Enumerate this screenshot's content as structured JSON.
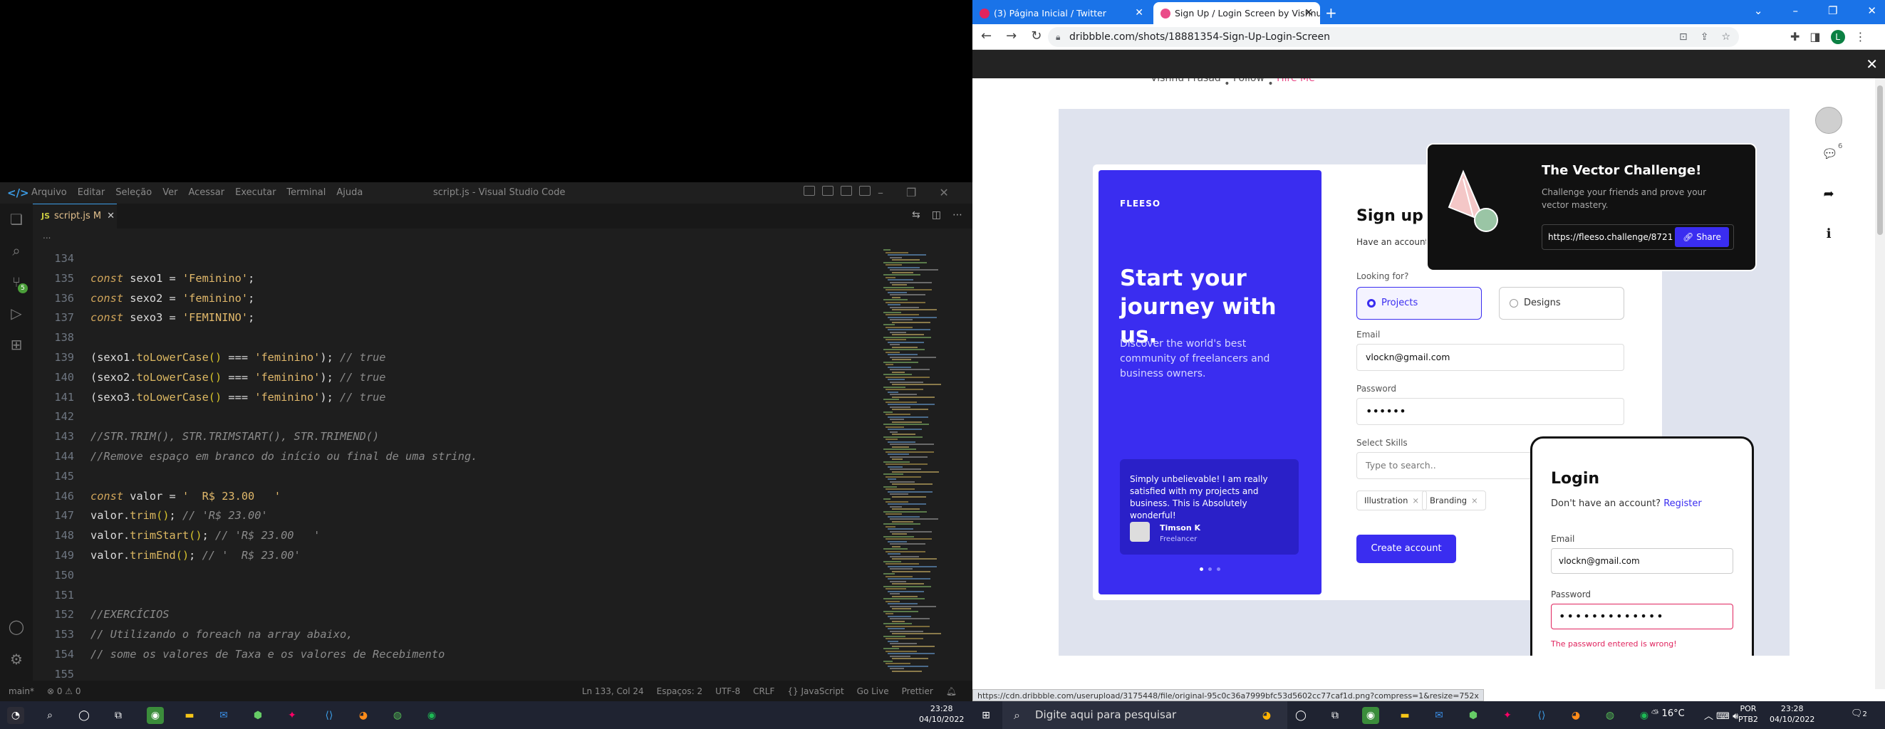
{
  "vscode": {
    "menu": [
      "Arquivo",
      "Editar",
      "Seleção",
      "Ver",
      "Acessar",
      "Executar",
      "Terminal",
      "Ajuda"
    ],
    "window_title": "script.js - Visual Studio Code",
    "tab": {
      "label": "script.js",
      "modified": "M"
    },
    "breadcrumb": "...",
    "lines": [
      {
        "n": "134",
        "tokens": []
      },
      {
        "n": "135",
        "tokens": [
          [
            "kw",
            "const"
          ],
          [
            "t",
            " sexo1 = "
          ],
          [
            "str",
            "'Feminino'"
          ],
          [
            "t",
            ";"
          ]
        ]
      },
      {
        "n": "136",
        "tokens": [
          [
            "kw",
            "const"
          ],
          [
            "t",
            " sexo2 = "
          ],
          [
            "str",
            "'feminino'"
          ],
          [
            "t",
            ";"
          ]
        ]
      },
      {
        "n": "137",
        "tokens": [
          [
            "kw",
            "const"
          ],
          [
            "t",
            " sexo3 = "
          ],
          [
            "str",
            "'FEMININO'"
          ],
          [
            "t",
            ";"
          ]
        ]
      },
      {
        "n": "138",
        "tokens": []
      },
      {
        "n": "139",
        "tokens": [
          [
            "t",
            "(sexo1."
          ],
          [
            "fn",
            "toLowerCase"
          ],
          [
            "pa",
            "()"
          ],
          [
            "t",
            " === "
          ],
          [
            "str",
            "'feminino'"
          ],
          [
            "t",
            "); "
          ],
          [
            "cm",
            "// true"
          ]
        ]
      },
      {
        "n": "140",
        "tokens": [
          [
            "t",
            "(sexo2."
          ],
          [
            "fn",
            "toLowerCase"
          ],
          [
            "pa",
            "()"
          ],
          [
            "t",
            " === "
          ],
          [
            "str",
            "'feminino'"
          ],
          [
            "t",
            "); "
          ],
          [
            "cm",
            "// true"
          ]
        ]
      },
      {
        "n": "141",
        "tokens": [
          [
            "t",
            "(sexo3."
          ],
          [
            "fn",
            "toLowerCase"
          ],
          [
            "pa",
            "()"
          ],
          [
            "t",
            " === "
          ],
          [
            "str",
            "'feminino'"
          ],
          [
            "t",
            "); "
          ],
          [
            "cm",
            "// true"
          ]
        ]
      },
      {
        "n": "142",
        "tokens": []
      },
      {
        "n": "143",
        "tokens": [
          [
            "cm",
            "//STR.TRIM(), STR.TRIMSTART(), STR.TRIMEND()"
          ]
        ]
      },
      {
        "n": "144",
        "tokens": [
          [
            "cm",
            "//Remove espaço em branco do início ou final de uma string."
          ]
        ]
      },
      {
        "n": "145",
        "tokens": []
      },
      {
        "n": "146",
        "tokens": [
          [
            "kw",
            "const"
          ],
          [
            "t",
            " valor = "
          ],
          [
            "str",
            "'  R$ 23.00   '"
          ]
        ]
      },
      {
        "n": "147",
        "tokens": [
          [
            "t",
            "valor."
          ],
          [
            "fn",
            "trim"
          ],
          [
            "pa",
            "()"
          ],
          [
            "t",
            "; "
          ],
          [
            "cm",
            "// 'R$ 23.00'"
          ]
        ]
      },
      {
        "n": "148",
        "tokens": [
          [
            "t",
            "valor."
          ],
          [
            "fn",
            "trimStart"
          ],
          [
            "pa",
            "()"
          ],
          [
            "t",
            "; "
          ],
          [
            "cm",
            "// 'R$ 23.00   '"
          ]
        ]
      },
      {
        "n": "149",
        "tokens": [
          [
            "t",
            "valor."
          ],
          [
            "fn",
            "trimEnd"
          ],
          [
            "pa",
            "()"
          ],
          [
            "t",
            "; "
          ],
          [
            "cm",
            "// '  R$ 23.00'"
          ]
        ]
      },
      {
        "n": "150",
        "tokens": []
      },
      {
        "n": "151",
        "tokens": []
      },
      {
        "n": "152",
        "tokens": [
          [
            "cm",
            "//EXERCÍCIOS"
          ]
        ]
      },
      {
        "n": "153",
        "tokens": [
          [
            "cm",
            "// Utilizando o foreach na array abaixo,"
          ]
        ]
      },
      {
        "n": "154",
        "tokens": [
          [
            "cm",
            "// some os valores de Taxa e os valores de Recebimento"
          ]
        ]
      },
      {
        "n": "155",
        "tokens": []
      }
    ],
    "status_left": [
      "main*",
      "⊗ 0 ⚠ 0"
    ],
    "status_right": [
      "Ln 133, Col 24",
      "Espaços: 2",
      "UTF-8",
      "CRLF",
      "{} JavaScript",
      "Go Live",
      "Prettier"
    ]
  },
  "chrome": {
    "tabs": [
      {
        "title": "(3) Página Inicial / Twitter",
        "active": false,
        "color": "#e0245e"
      },
      {
        "title": "Sign Up / Login Screen by Vishnu",
        "active": true,
        "color": "#ea4c89"
      }
    ],
    "url": "dribbble.com/shots/18881354-Sign-Up-Login-Screen",
    "avatar_letter": "L",
    "status_url": "https://cdn.dribbble.com/userupload/3175448/file/original-95c0c36a7999bfc53d5602cc77caf1d.png?compress=1&resize=752x"
  },
  "dribbble": {
    "author": "Vishnu Prasad",
    "follow": "Follow",
    "hire": "Hire Me",
    "comment_count": "6",
    "shot": {
      "brand": "FLEESO",
      "headline": "Start your journey with us.",
      "subline": "Discover the world's best community of freelancers and business owners.",
      "testimonial": "Simply unbelievable! I am really satisfied with my projects and business. This is Absolutely wonderful!",
      "testimonial_name": "Timson K",
      "testimonial_role": "Freelancer",
      "signup_title": "Sign up",
      "have_account": "Have an account",
      "looking_for": "Looking for?",
      "opt_projects": "Projects",
      "opt_designs": "Designs",
      "email_label": "Email",
      "email_value": "vlockn@gmail.com",
      "password_label": "Password",
      "password_value": "••••••",
      "skills_label": "Select Skills",
      "skills_placeholder": "Type to search..",
      "chip1": "Illustration",
      "chip2": "Branding",
      "create": "Create account",
      "vec_title": "The Vector Challenge!",
      "vec_desc": "Challenge your friends and prove your vector mastery.",
      "vec_url": "https://fleeso.challenge/8721",
      "vec_share": "Share",
      "login_title": "Login",
      "login_q": "Don't have an account?",
      "login_register": "Register",
      "login_email_label": "Email",
      "login_email": "vlockn@gmail.com",
      "login_password_label": "Password",
      "login_password": "•••••••••••••",
      "login_error": "The password entered is wrong!"
    }
  },
  "taskbar": {
    "search_placeholder": "Digite aqui para pesquisar",
    "weather": "16°C",
    "lang": "POR",
    "layout": "PTB2",
    "time": "23:28",
    "date": "04/10/2022",
    "notif_count": "2"
  }
}
